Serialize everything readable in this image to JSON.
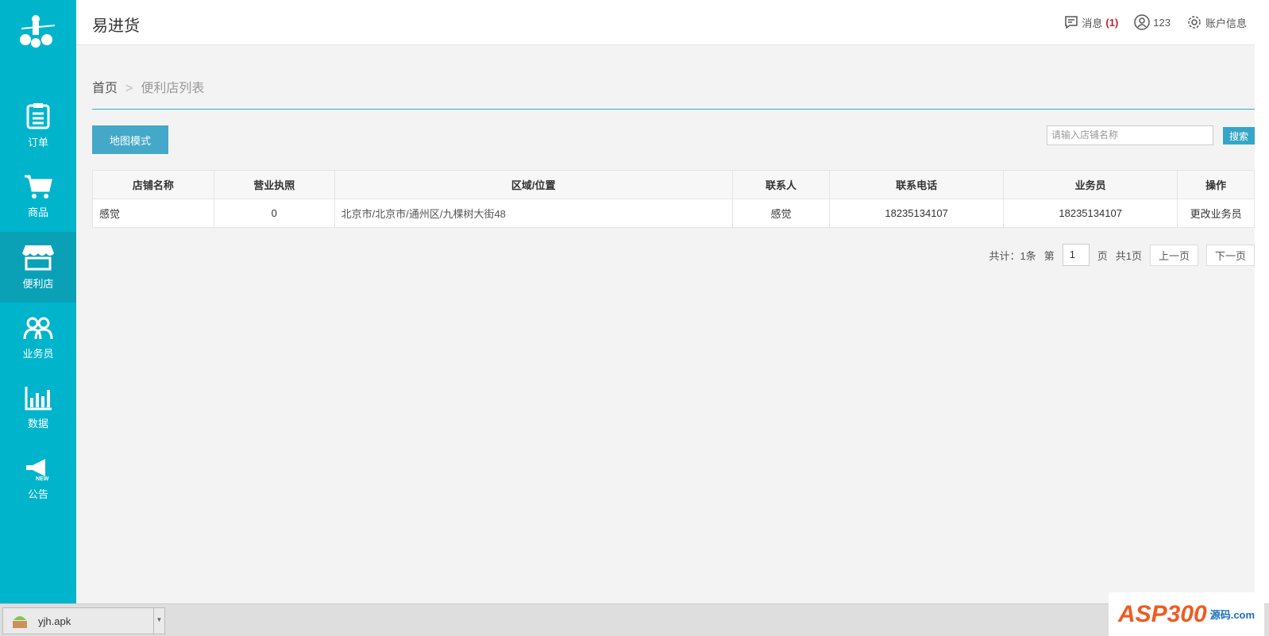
{
  "app": {
    "title": "易进货"
  },
  "sidebar": {
    "items": [
      {
        "label": "订单",
        "icon": "clipboard-icon"
      },
      {
        "label": "商品",
        "icon": "cart-icon"
      },
      {
        "label": "便利店",
        "icon": "store-icon"
      },
      {
        "label": "业务员",
        "icon": "users-icon"
      },
      {
        "label": "数据",
        "icon": "bar-chart-icon"
      },
      {
        "label": "公告",
        "icon": "megaphone-icon"
      }
    ]
  },
  "header": {
    "messages_label": "消息",
    "messages_count": "(1)",
    "user": "123",
    "account_label": "账户信息"
  },
  "breadcrumb": {
    "home": "首页",
    "sep": ">",
    "current": "便利店列表"
  },
  "toolbar": {
    "map_mode": "地图模式",
    "search_placeholder": "请输入店铺名称",
    "search_label": "搜索"
  },
  "table": {
    "headers": [
      "店铺名称",
      "营业执照",
      "区域/位置",
      "联系人",
      "联系电话",
      "业务员",
      "操作"
    ],
    "rows": [
      [
        "感觉",
        "0",
        "北京市/北京市/通州区/九棵树大街48",
        "感觉",
        "18235134107",
        "18235134107",
        "更改业务员"
      ]
    ]
  },
  "pager": {
    "total": "共计：1条",
    "page_prefix": "第",
    "page": "1",
    "page_suffix": "页",
    "total_pages": "共1页",
    "prev": "上一页",
    "next": "下一页"
  },
  "download": {
    "file": "yjh.apk"
  },
  "watermark": {
    "text": "ASP300",
    "sub": "源码.com"
  }
}
